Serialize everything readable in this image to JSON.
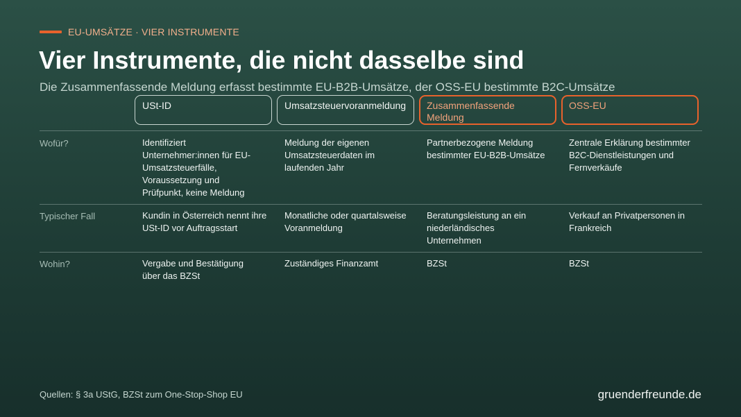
{
  "kicker": "EU-UMSÄTZE · VIER INSTRUMENTE",
  "title": "Vier Instrumente, die nicht dasselbe sind",
  "subtitle": "Die Zusammenfassende Meldung erfasst bestimmte EU-B2B-Umsätze, der OSS-EU bestimmte B2C-Umsätze",
  "colors": {
    "accent": "#e8622c",
    "background": "#234740",
    "muted_text": "#a7bdb5"
  },
  "table": {
    "columns": [
      {
        "label": "USt-ID",
        "highlight": false
      },
      {
        "label": "Umsatzsteuervoranmeldung",
        "highlight": false
      },
      {
        "label": "Zusammenfassende Meldung",
        "highlight": true
      },
      {
        "label": "OSS-EU",
        "highlight": true
      }
    ],
    "rows": [
      {
        "label": "Wofür?",
        "cells": [
          "Identifiziert Unternehmer:innen für EU-Umsatzsteuerfälle, Voraussetzung und Prüfpunkt, keine Meldung",
          "Meldung der eigenen Umsatzsteuerdaten im laufenden Jahr",
          "Partnerbezogene Meldung bestimmter EU-B2B-Umsätze",
          "Zentrale Erklärung bestimmter B2C-Dienstleistungen und Fernverkäufe"
        ]
      },
      {
        "label": "Typischer Fall",
        "cells": [
          "Kundin in Österreich nennt ihre USt-ID vor Auftragsstart",
          "Monatliche oder quartalsweise Voranmeldung",
          "Beratungsleistung an ein niederländisches Unternehmen",
          "Verkauf an Privatpersonen in Frankreich"
        ]
      },
      {
        "label": "Wohin?",
        "cells": [
          "Vergabe und Bestätigung über das BZSt",
          "Zuständiges Finanzamt",
          "BZSt",
          "BZSt"
        ]
      }
    ]
  },
  "footer": {
    "sources": "Quellen: § 3a UStG, BZSt zum One-Stop-Shop EU",
    "brand": "gruenderfreunde.de"
  }
}
